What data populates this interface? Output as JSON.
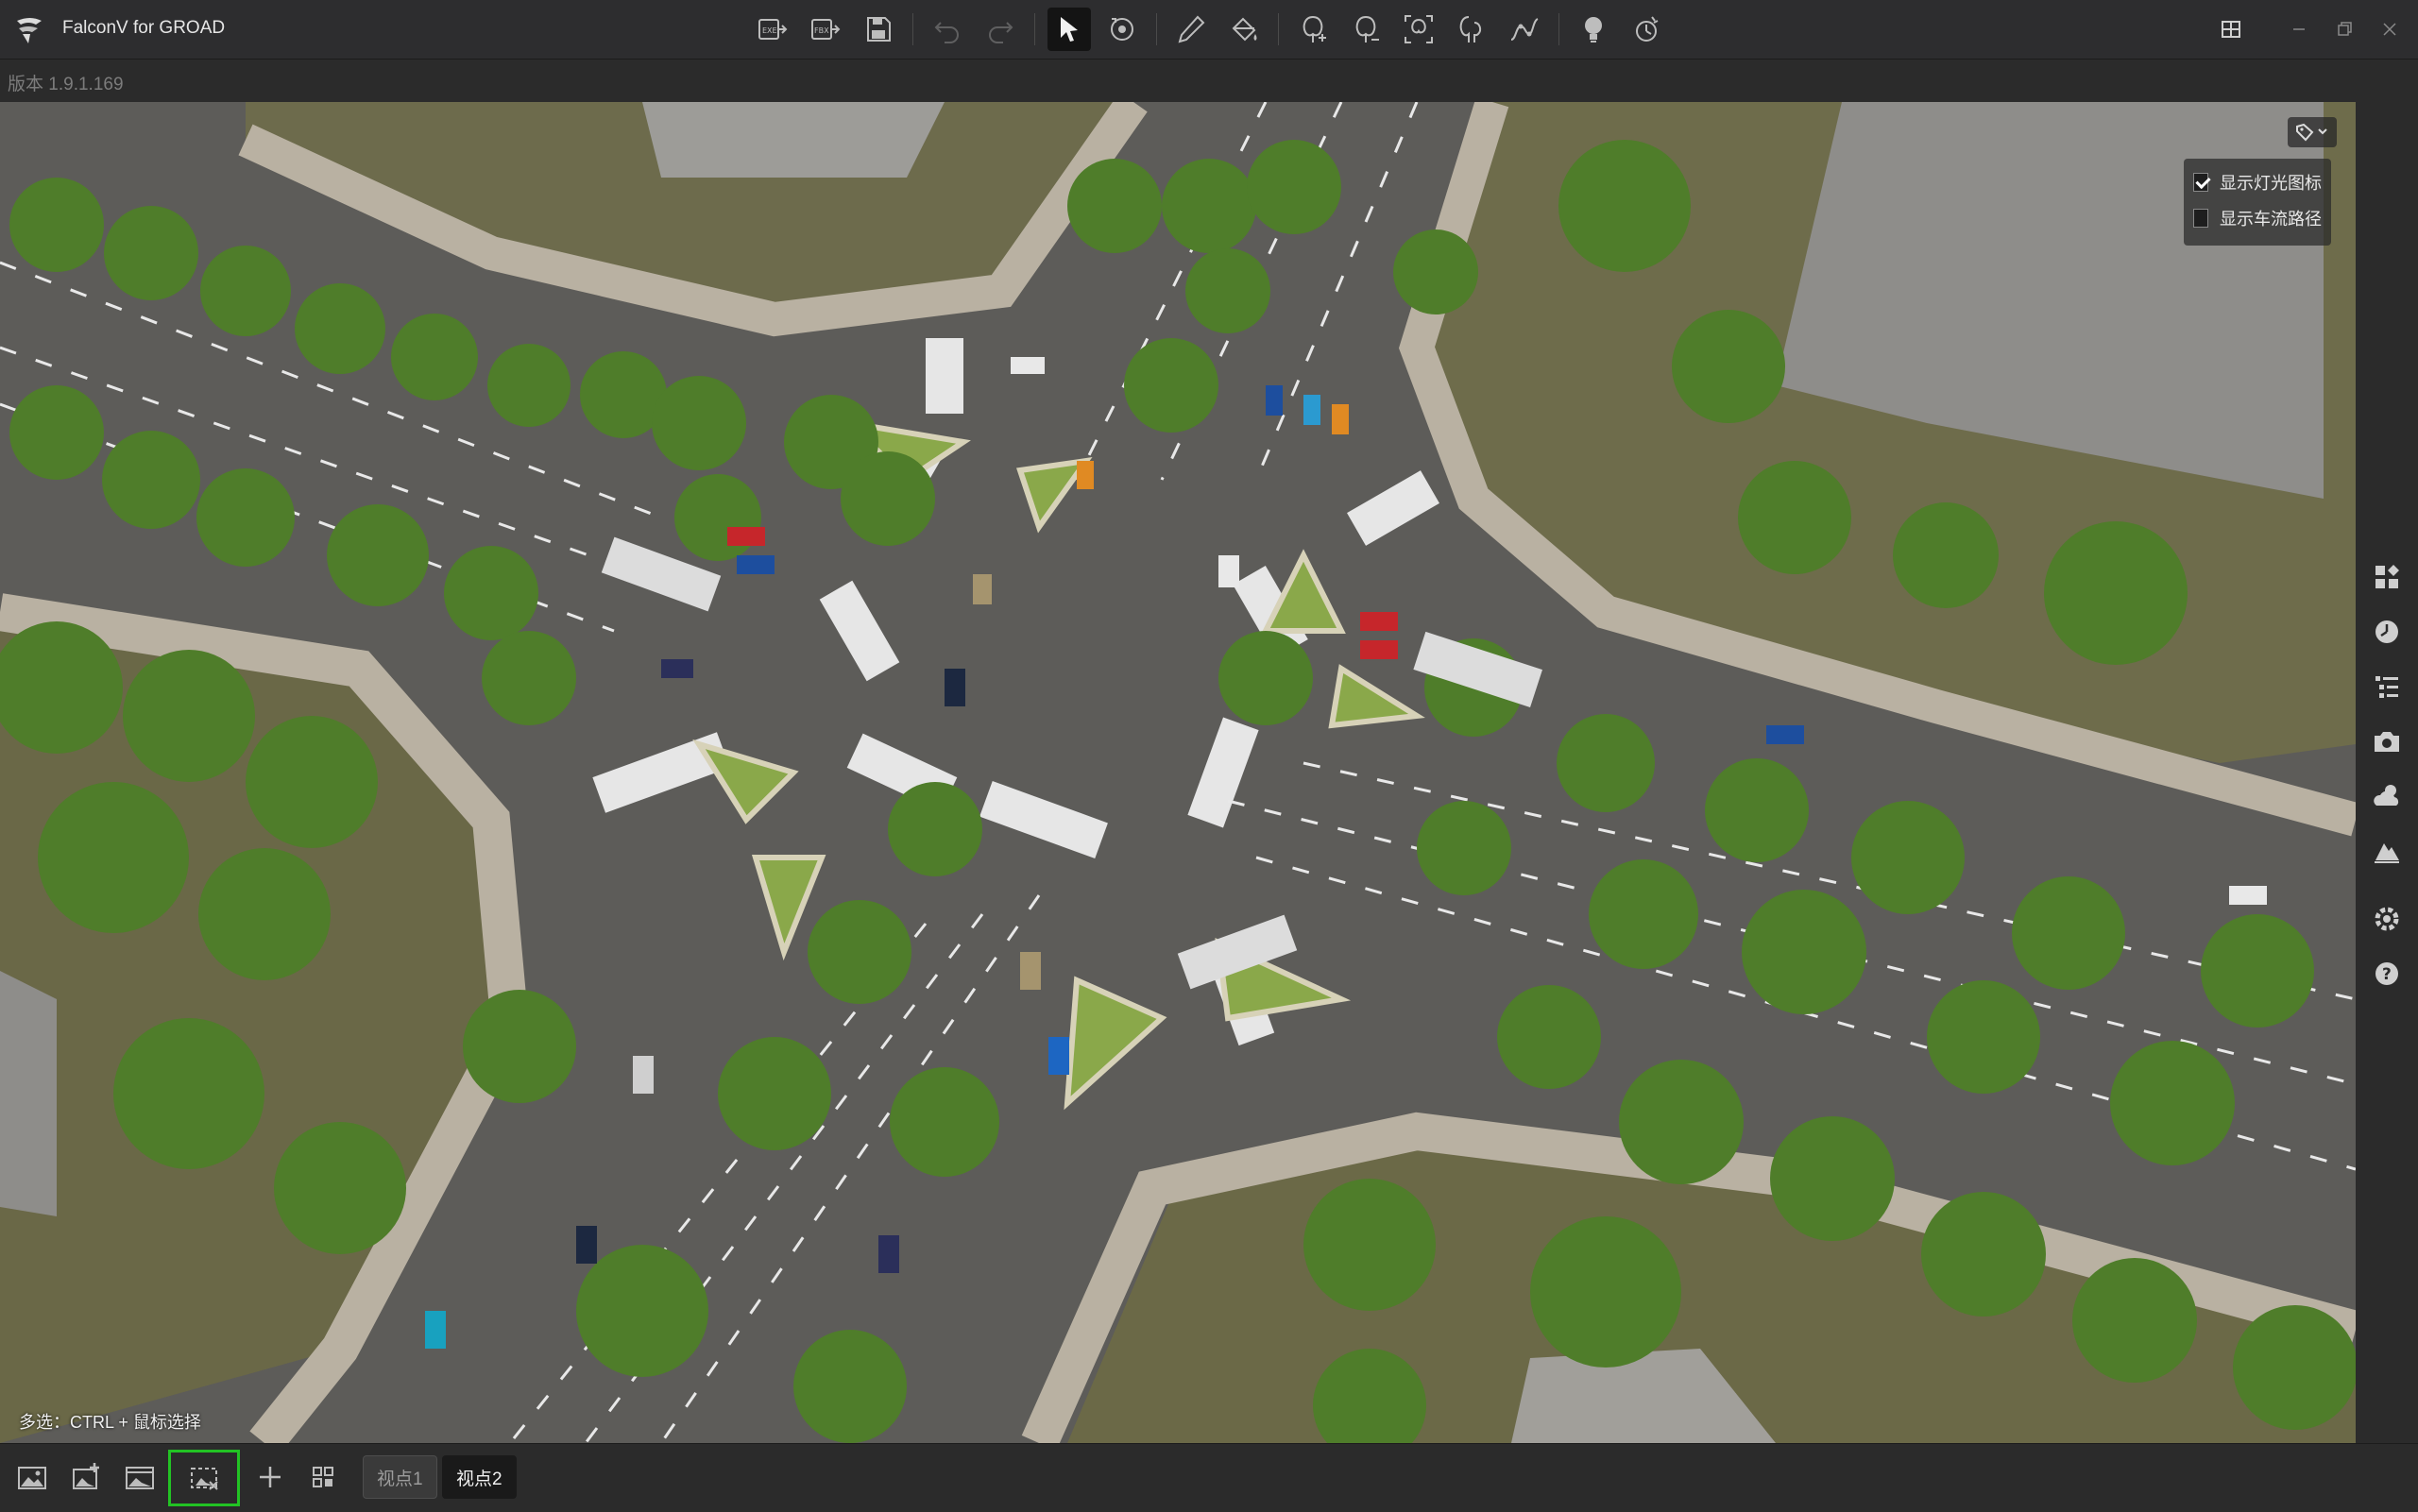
{
  "app": {
    "title": "FalconV for GROAD",
    "version": "版本 1.9.1.169"
  },
  "toolbar": {
    "groups": [
      [
        "import-exe-icon",
        "import-file-icon",
        "save-icon"
      ],
      [
        "undo-icon",
        "redo-icon"
      ],
      [
        "select-pointer-icon",
        "orbit-camera-icon"
      ],
      [
        "pen-draw-icon",
        "fill-bucket-icon"
      ],
      [
        "tree-add-icon",
        "tree-remove-icon",
        "tree-select-icon",
        "tree-edit-icon",
        "curve-path-icon"
      ],
      [
        "light-bulb-icon",
        "time-of-day-icon"
      ]
    ],
    "active": "select-pointer-icon"
  },
  "window_controls": [
    "layout-grid-icon",
    "minimize-icon",
    "restore-icon",
    "close-icon"
  ],
  "viewport": {
    "overlay_options": [
      {
        "label": "显示灯光图标",
        "checked": true
      },
      {
        "label": "显示车流路径",
        "checked": false
      }
    ],
    "hint": "多选：CTRL + 鼠标选择"
  },
  "right_sidebar": [
    "assets-grid-icon",
    "weather-clock-icon",
    "layers-list-icon",
    "camera-icon",
    "cloud-weather-icon",
    "terrain-icon",
    "settings-gear-icon",
    "help-icon"
  ],
  "bottom_bar": {
    "tools": [
      "screenshot-icon",
      "screenshot-add-icon",
      "video-capture-icon",
      "multi-select-capture-icon"
    ],
    "add_label": "+",
    "viewpoints": [
      "视点1",
      "视点2"
    ],
    "active_viewpoint": "视点2"
  },
  "colors": {
    "background": "#2b2b2b",
    "highlight_border": "#22c324",
    "road": "#5f5e5b",
    "grass": "#6b6a4a",
    "tree": "#5c8c34"
  }
}
